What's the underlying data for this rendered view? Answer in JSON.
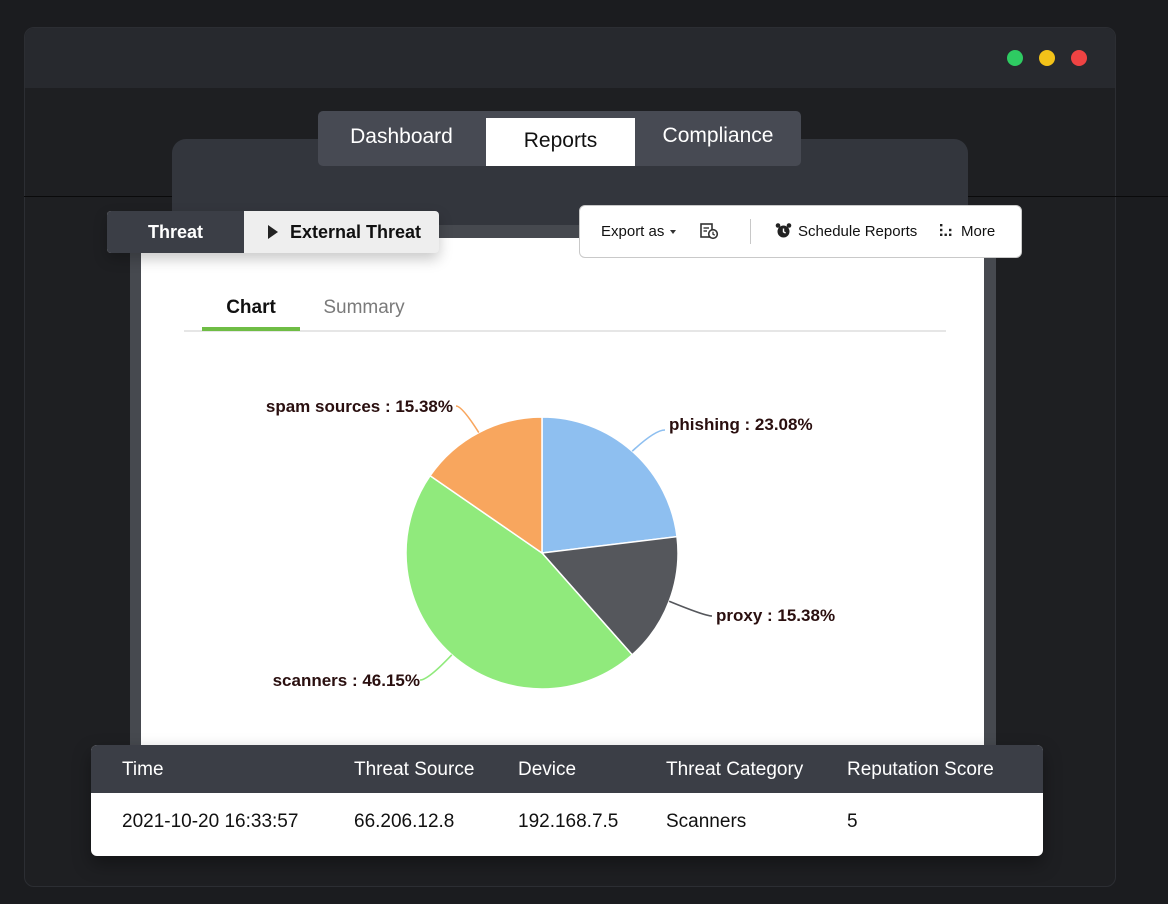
{
  "main_tabs": [
    "Dashboard",
    "Reports",
    "Compliance"
  ],
  "breadcrumb": {
    "parent": "Threat",
    "current": "External Threat"
  },
  "toolbar": {
    "export_label": "Export as",
    "schedule_label": "Schedule Reports",
    "more_label": "More"
  },
  "subtabs": {
    "chart": "Chart",
    "summary": "Summary"
  },
  "chart_data": {
    "type": "pie",
    "slices": [
      {
        "label": "phishing",
        "value": 23.08,
        "display": "phishing : 23.08%",
        "color": "#8ebff0"
      },
      {
        "label": "proxy",
        "value": 15.38,
        "display": "proxy : 15.38%",
        "color": "#55575c"
      },
      {
        "label": "scanners",
        "value": 46.15,
        "display": "scanners : 46.15%",
        "color": "#90ea7c"
      },
      {
        "label": "spam sources",
        "value": 15.38,
        "display": "spam sources : 15.38%",
        "color": "#f8a65e"
      }
    ]
  },
  "table": {
    "headers": [
      "Time",
      "Threat Source",
      "Device",
      "Threat Category",
      "Reputation Score"
    ],
    "rows": [
      [
        "2021-10-20 16:33:57",
        "66.206.12.8",
        "192.168.7.5",
        "Scanners",
        "5"
      ]
    ]
  },
  "colors": {
    "accent_green": "#6fbd45",
    "header_dark": "#3b3e46"
  }
}
